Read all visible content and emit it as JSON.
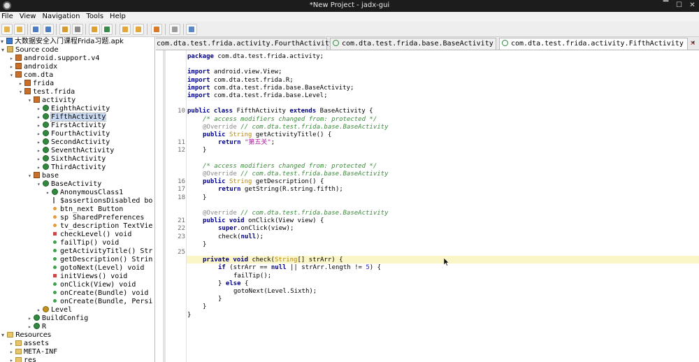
{
  "window": {
    "title": "*New Project - jadx-gui",
    "controls": [
      "▔",
      "☐",
      "✕"
    ]
  },
  "menu": [
    "File",
    "View",
    "Navigation",
    "Tools",
    "Help"
  ],
  "toolbar": {
    "icons": [
      "open-file-icon",
      "add-file-icon",
      "save-icon",
      "save-all-icon",
      "sync-icon",
      "flatten-icon",
      "search-icon",
      "find-class-icon",
      "back-icon",
      "forward-icon",
      "preferences-icon",
      "log-icon",
      "settings-icon"
    ]
  },
  "tree": {
    "apk": "大数据安全入门课程Frida习题.apk",
    "source_code": "Source code",
    "pkg_support": "android.support.v4",
    "pkg_androidx": "androidx",
    "pkg_comdta": "com.dta",
    "pkg_frida": "frida",
    "pkg_testfrida": "test.frida",
    "pkg_activity": "activity",
    "activities": [
      "EighthActivity",
      "FifthActivity",
      "FirstActivity",
      "FourthActivity",
      "SecondActivity",
      "SeventhActivity",
      "SixthActivity",
      "ThirdActivity"
    ],
    "pkg_base": "base",
    "base_activity": "BaseActivity",
    "members": [
      {
        "text": "AnonymousClass1",
        "kind": "class"
      },
      {
        "text": "$assertionsDisabled bo",
        "kind": "static"
      },
      {
        "text": "btn_next Button",
        "kind": "field"
      },
      {
        "text": "sp SharedPreferences",
        "kind": "field"
      },
      {
        "text": "tv_description TextVie",
        "kind": "field"
      },
      {
        "text": "checkLevel() void",
        "kind": "private"
      },
      {
        "text": "failTip() void",
        "kind": "public"
      },
      {
        "text": "getActivityTitle() Str",
        "kind": "public"
      },
      {
        "text": "getDescription() Strin",
        "kind": "public"
      },
      {
        "text": "gotoNext(Level) void",
        "kind": "public"
      },
      {
        "text": "initViews() void",
        "kind": "private"
      },
      {
        "text": "onClick(View) void",
        "kind": "public"
      },
      {
        "text": "onCreate(Bundle) void",
        "kind": "public"
      },
      {
        "text": "onCreate(Bundle, Persi",
        "kind": "public"
      }
    ],
    "level": "Level",
    "build_config": "BuildConfig",
    "r_class": "R",
    "resources": "Resources",
    "res_folders": [
      "assets",
      "META-INF",
      "res"
    ]
  },
  "tabs": [
    {
      "label": "com.dta.test.frida.activity.FourthActivity",
      "close": "✕"
    },
    {
      "label": "com.dta.test.frida.base.BaseActivity",
      "close": "✕"
    },
    {
      "label": "com.dta.test.frida.activity.FifthActivity",
      "close": "✕"
    }
  ],
  "tab_scroll": [
    "◂",
    "▸"
  ],
  "code": {
    "line_numbers": [
      {
        "row": 7,
        "n": "10"
      },
      {
        "row": 11,
        "n": "11"
      },
      {
        "row": 12,
        "n": "12"
      },
      {
        "row": 16,
        "n": "16"
      },
      {
        "row": 17,
        "n": "17"
      },
      {
        "row": 18,
        "n": "18"
      },
      {
        "row": 21,
        "n": "21"
      },
      {
        "row": 22,
        "n": "22"
      },
      {
        "row": 23,
        "n": "23"
      },
      {
        "row": 25,
        "n": "25"
      }
    ],
    "lines": [
      {
        "row": 0,
        "indent": 0,
        "tokens": [
          {
            "t": "package",
            "c": "kw"
          },
          {
            "t": " com.dta.test.frida.activity;",
            "c": ""
          }
        ]
      },
      {
        "row": 2,
        "indent": 0,
        "tokens": [
          {
            "t": "import",
            "c": "kw"
          },
          {
            "t": " android.view.View;",
            "c": ""
          }
        ]
      },
      {
        "row": 3,
        "indent": 0,
        "tokens": [
          {
            "t": "import",
            "c": "kw"
          },
          {
            "t": " com.dta.test.frida.R;",
            "c": ""
          }
        ]
      },
      {
        "row": 4,
        "indent": 0,
        "tokens": [
          {
            "t": "import",
            "c": "kw"
          },
          {
            "t": " com.dta.test.frida.base.BaseActivity;",
            "c": ""
          }
        ]
      },
      {
        "row": 5,
        "indent": 0,
        "tokens": [
          {
            "t": "import",
            "c": "kw"
          },
          {
            "t": " com.dta.test.frida.base.Level;",
            "c": ""
          }
        ]
      },
      {
        "row": 7,
        "indent": 0,
        "tokens": [
          {
            "t": "public class",
            "c": "kw"
          },
          {
            "t": " FifthActivity ",
            "c": ""
          },
          {
            "t": "extends",
            "c": "kw"
          },
          {
            "t": " BaseActivity {",
            "c": ""
          }
        ]
      },
      {
        "row": 8,
        "indent": 1,
        "tokens": [
          {
            "t": "/* access modifiers changed from: protected */",
            "c": "cm"
          }
        ]
      },
      {
        "row": 9,
        "indent": 1,
        "tokens": [
          {
            "t": "@Override",
            "c": "an"
          },
          {
            "t": " // com.dta.test.frida.base.BaseActivity",
            "c": "cm"
          }
        ]
      },
      {
        "row": 10,
        "indent": 1,
        "tokens": [
          {
            "t": "public",
            "c": "kw"
          },
          {
            "t": " ",
            "c": ""
          },
          {
            "t": "String",
            "c": "tp"
          },
          {
            "t": " getActivityTitle() {",
            "c": ""
          }
        ]
      },
      {
        "row": 11,
        "indent": 2,
        "tokens": [
          {
            "t": "return",
            "c": "kw"
          },
          {
            "t": " ",
            "c": ""
          },
          {
            "t": "\"第五关\"",
            "c": "st"
          },
          {
            "t": ";",
            "c": ""
          }
        ]
      },
      {
        "row": 12,
        "indent": 1,
        "tokens": [
          {
            "t": "}",
            "c": ""
          }
        ]
      },
      {
        "row": 14,
        "indent": 1,
        "tokens": [
          {
            "t": "/* access modifiers changed from: protected */",
            "c": "cm"
          }
        ]
      },
      {
        "row": 15,
        "indent": 1,
        "tokens": [
          {
            "t": "@Override",
            "c": "an"
          },
          {
            "t": " // com.dta.test.frida.base.BaseActivity",
            "c": "cm"
          }
        ]
      },
      {
        "row": 16,
        "indent": 1,
        "tokens": [
          {
            "t": "public",
            "c": "kw"
          },
          {
            "t": " ",
            "c": ""
          },
          {
            "t": "String",
            "c": "tp"
          },
          {
            "t": " getDescription() {",
            "c": ""
          }
        ]
      },
      {
        "row": 17,
        "indent": 2,
        "tokens": [
          {
            "t": "return",
            "c": "kw"
          },
          {
            "t": " getString(R.string.fifth);",
            "c": ""
          }
        ]
      },
      {
        "row": 18,
        "indent": 1,
        "tokens": [
          {
            "t": "}",
            "c": ""
          }
        ]
      },
      {
        "row": 20,
        "indent": 1,
        "tokens": [
          {
            "t": "@Override",
            "c": "an"
          },
          {
            "t": " // com.dta.test.frida.base.BaseActivity",
            "c": "cm"
          }
        ]
      },
      {
        "row": 21,
        "indent": 1,
        "tokens": [
          {
            "t": "public void",
            "c": "kw"
          },
          {
            "t": " onClick(View view) {",
            "c": ""
          }
        ]
      },
      {
        "row": 22,
        "indent": 2,
        "tokens": [
          {
            "t": "super",
            "c": "kw"
          },
          {
            "t": ".onClick(view);",
            "c": ""
          }
        ]
      },
      {
        "row": 23,
        "indent": 2,
        "tokens": [
          {
            "t": "check(",
            "c": ""
          },
          {
            "t": "null",
            "c": "kw"
          },
          {
            "t": ");",
            "c": ""
          }
        ]
      },
      {
        "row": 24,
        "indent": 1,
        "tokens": [
          {
            "t": "}",
            "c": ""
          }
        ]
      },
      {
        "row": 26,
        "indent": 1,
        "tokens": [
          {
            "t": "private void",
            "c": "kw"
          },
          {
            "t": " check(",
            "c": ""
          },
          {
            "t": "String",
            "c": "tp"
          },
          {
            "t": "[] strArr) {",
            "c": ""
          }
        ]
      },
      {
        "row": 27,
        "indent": 2,
        "tokens": [
          {
            "t": "if",
            "c": "kw"
          },
          {
            "t": " (strArr == ",
            "c": ""
          },
          {
            "t": "null",
            "c": "kw"
          },
          {
            "t": " || strArr.length != ",
            "c": ""
          },
          {
            "t": "5",
            "c": "nu"
          },
          {
            "t": ") {",
            "c": ""
          }
        ]
      },
      {
        "row": 28,
        "indent": 3,
        "tokens": [
          {
            "t": "failTip();",
            "c": ""
          }
        ]
      },
      {
        "row": 29,
        "indent": 2,
        "tokens": [
          {
            "t": "} ",
            "c": ""
          },
          {
            "t": "else",
            "c": "kw"
          },
          {
            "t": " {",
            "c": ""
          }
        ]
      },
      {
        "row": 30,
        "indent": 3,
        "tokens": [
          {
            "t": "gotoNext(Level.Sixth);",
            "c": ""
          }
        ]
      },
      {
        "row": 31,
        "indent": 2,
        "tokens": [
          {
            "t": "}",
            "c": ""
          }
        ]
      },
      {
        "row": 32,
        "indent": 1,
        "tokens": [
          {
            "t": "}",
            "c": ""
          }
        ]
      },
      {
        "row": 33,
        "indent": 0,
        "tokens": [
          {
            "t": "}",
            "c": ""
          }
        ]
      }
    ]
  }
}
